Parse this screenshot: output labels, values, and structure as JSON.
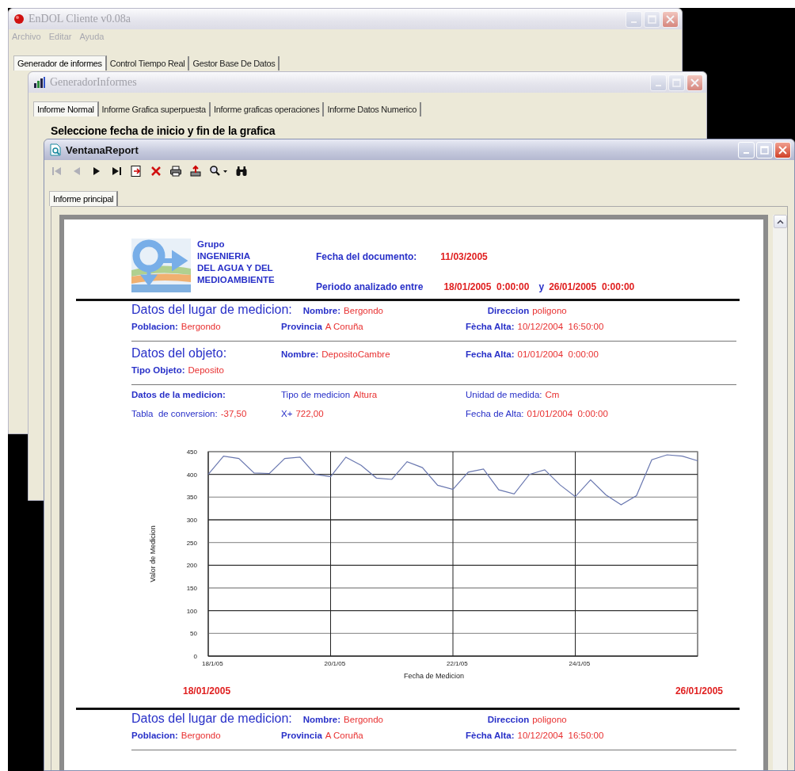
{
  "main_window": {
    "title": "EnDOL Cliente v0.08a",
    "active": false,
    "menu": [
      {
        "label": "Archivo",
        "disabled": true
      },
      {
        "label": "Editar",
        "disabled": true
      },
      {
        "label": "Ayuda",
        "disabled": true
      }
    ],
    "tabs": [
      {
        "label": "Generador de informes",
        "selected": true
      },
      {
        "label": "Control Tiempo Real",
        "selected": false
      },
      {
        "label": "Gestor Base De Datos",
        "selected": false
      }
    ]
  },
  "generator_window": {
    "title": "GeneradorInformes",
    "active": false,
    "tabs": [
      {
        "label": "Informe Normal",
        "selected": true
      },
      {
        "label": "Informe Grafica superpuesta",
        "selected": false
      },
      {
        "label": "Informe graficas operaciones",
        "selected": false
      },
      {
        "label": "Informe Datos Numerico",
        "selected": false
      }
    ],
    "prompt": "Seleccione fecha de inicio y fin de la grafica"
  },
  "report_window": {
    "title": "VentanaReport",
    "active": true,
    "toolbar": [
      {
        "kind": "first",
        "disabled": true
      },
      {
        "kind": "previous",
        "disabled": true
      },
      {
        "kind": "next",
        "disabled": false
      },
      {
        "kind": "last",
        "disabled": false
      },
      {
        "kind": "export",
        "disabled": false
      },
      {
        "kind": "close",
        "disabled": false
      },
      {
        "kind": "print",
        "disabled": false
      },
      {
        "kind": "save",
        "disabled": false
      },
      {
        "kind": "zoom",
        "disabled": false
      },
      {
        "kind": "find",
        "disabled": false
      }
    ],
    "tabs": [
      {
        "label": "Informe principal",
        "selected": true
      }
    ],
    "report": {
      "logo_lines": [
        "Grupo",
        "INGENIERIA",
        "DEL AGUA Y DEL",
        "MEDIOAMBIENTE"
      ],
      "document_date": {
        "label": "Fecha del documento:",
        "value": "11/03/2005"
      },
      "period": {
        "label": "Periodo analizado entre",
        "start": "18/01/2005  0:00:00",
        "separator": "y",
        "end": "26/01/2005  0:00:00"
      },
      "sections": [
        {
          "kind": "heavy-rule"
        },
        {
          "kind": "row",
          "cells": [
            {
              "kind": "heading",
              "label": "Datos del lugar de medicion:"
            },
            {
              "kind": "field",
              "label": "Nombre:",
              "value": "Bergondo"
            },
            {
              "kind": "field",
              "label": "Direccion",
              "value": "poligono"
            }
          ]
        },
        {
          "kind": "row",
          "cells": [
            {
              "kind": "field",
              "label": "Poblacion:",
              "value": "Bergondo"
            },
            {
              "kind": "field",
              "label": "Provincia",
              "value": "A Coruña"
            },
            {
              "kind": "field",
              "label": "Fècha Alta:",
              "value": "10/12/2004  16:50:00"
            }
          ]
        },
        {
          "kind": "rule"
        },
        {
          "kind": "row",
          "cells": [
            {
              "kind": "heading",
              "label": "Datos del objeto:"
            },
            {
              "kind": "field",
              "label": "Nombre:",
              "value": "DepositoCambre"
            },
            {
              "kind": "field",
              "label": "Fecha Alta:",
              "value": "01/01/2004  0:00:00"
            }
          ]
        },
        {
          "kind": "row",
          "cells": [
            {
              "kind": "field",
              "label": "Tipo Objeto:",
              "value": "Deposito"
            }
          ]
        },
        {
          "kind": "rule"
        },
        {
          "kind": "row",
          "cells": [
            {
              "kind": "field",
              "label": "Datos de la medicion:"
            },
            {
              "kind": "plain",
              "label": "Tipo de medicion",
              "value": "Altura"
            },
            {
              "kind": "plain",
              "label": "Unidad de medida:",
              "value": "Cm"
            }
          ]
        },
        {
          "kind": "row",
          "cells": [
            {
              "kind": "plain",
              "label": "Tabla  de conversion:",
              "value": "-37,50"
            },
            {
              "kind": "plain",
              "label": "X+",
              "value": "722,00"
            },
            {
              "kind": "plain",
              "label": "Fecha de Alta:",
              "value": "01/01/2004  0:00:00"
            }
          ]
        }
      ],
      "chart_data": {
        "type": "line",
        "xlabel": "Fecha de Medicion",
        "ylabel": "Valor de Medicion",
        "categories": [
          "18/1/05",
          null,
          null,
          null,
          null,
          null,
          null,
          null,
          "20/1/05",
          null,
          null,
          null,
          null,
          null,
          null,
          null,
          "22/1/05",
          null,
          null,
          null,
          null,
          null,
          null,
          null,
          "24/1/05",
          null,
          null,
          null,
          null,
          null,
          null,
          null,
          null
        ],
        "series": [
          {
            "color": "#6a78b0",
            "values": [
              400,
              440,
              435,
              403,
              402,
              435,
              438,
              400,
              395,
              438,
              420,
              392,
              389,
              428,
              415,
              376,
              367,
              405,
              412,
              366,
              357,
              400,
              410,
              377,
              351,
              388,
              355,
              333,
              353,
              432,
              443,
              440,
              430
            ]
          }
        ],
        "ylim": [
          0,
          450
        ],
        "grid": true,
        "yticks": [
          0,
          50,
          100,
          150,
          200,
          250,
          300,
          350,
          400,
          450
        ]
      },
      "range_start": "18/01/2005",
      "range_end": "26/01/2005",
      "sections_after": [
        {
          "kind": "heavy-rule"
        },
        {
          "kind": "row",
          "cells": [
            {
              "kind": "heading",
              "label": "Datos del lugar de medicion:"
            },
            {
              "kind": "field",
              "label": "Nombre:",
              "value": "Bergondo"
            },
            {
              "kind": "field",
              "label": "Direccion",
              "value": "poligono"
            }
          ]
        },
        {
          "kind": "row",
          "cells": [
            {
              "kind": "field",
              "label": "Poblacion:",
              "value": "Bergondo"
            },
            {
              "kind": "field",
              "label": "Provincia",
              "value": "A Coruña"
            },
            {
              "kind": "field",
              "label": "Fècha Alta:",
              "value": "10/12/2004  16:50:00"
            }
          ]
        },
        {
          "kind": "rule"
        }
      ]
    }
  }
}
